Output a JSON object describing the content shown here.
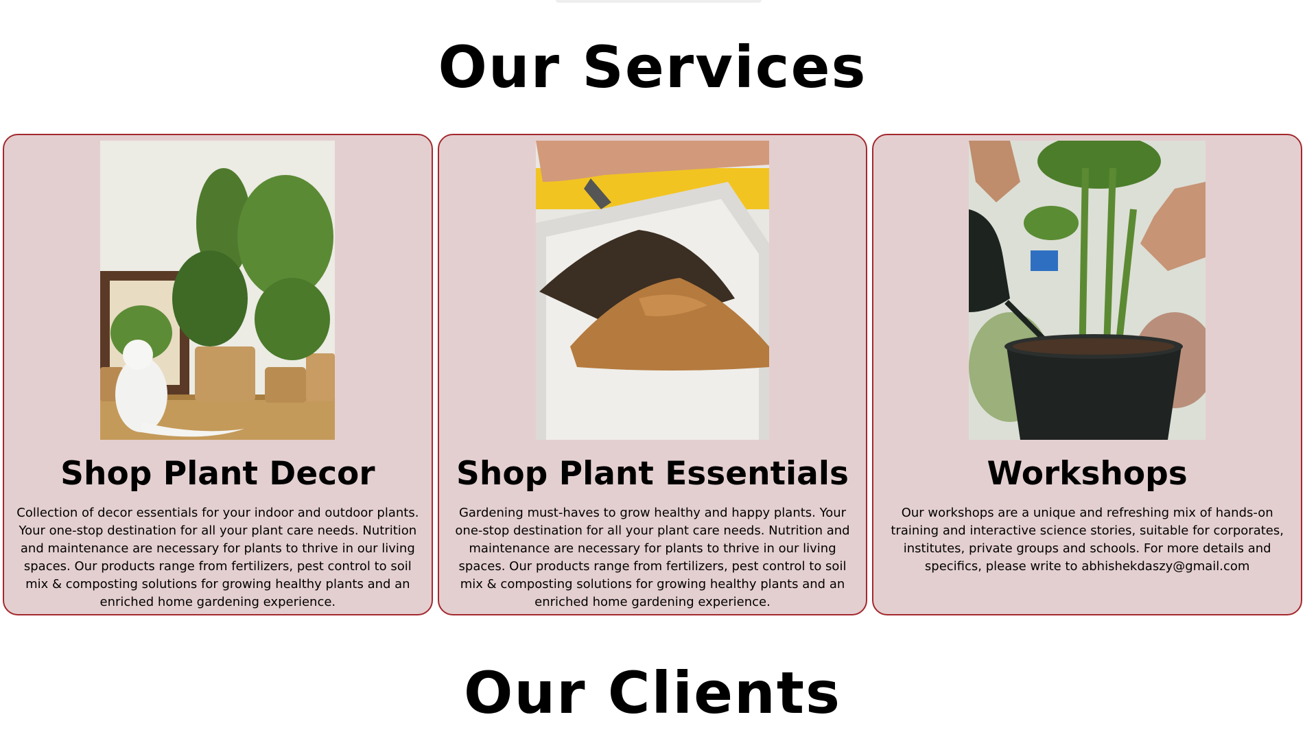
{
  "services": {
    "title": "Our Services",
    "cards": [
      {
        "title": "Shop Plant Decor",
        "image": "plant-decor-photo",
        "description": "Collection of decor essentials for your indoor and outdoor plants. Your one-stop destination for all your plant care needs. Nutrition and maintenance are necessary for plants to thrive in our living spaces. Our products range from fertilizers, pest control to soil mix & composting solutions for growing healthy plants and an enriched home gardening experience."
      },
      {
        "title": "Shop Plant Essentials",
        "image": "soil-mix-photo",
        "description": "Gardening must-haves to grow healthy and happy plants. Your one-stop destination for all your plant care needs. Nutrition and maintenance are necessary for plants to thrive in our living spaces. Our products range from fertilizers, pest control to soil mix & composting solutions for growing healthy plants and an enriched home gardening experience."
      },
      {
        "title": "Workshops",
        "image": "watering-plant-photo",
        "description": "Our workshops are a unique and refreshing mix of hands-on training and interactive science stories, suitable for corporates, institutes, private groups and schools. For more details and specifics, please write to abhishekdaszy@gmail.com"
      }
    ]
  },
  "clients": {
    "title": "Our Clients"
  },
  "colors": {
    "card_background": "#e4cfd0",
    "card_border": "#a3282e",
    "page_background": "#ffffff"
  }
}
